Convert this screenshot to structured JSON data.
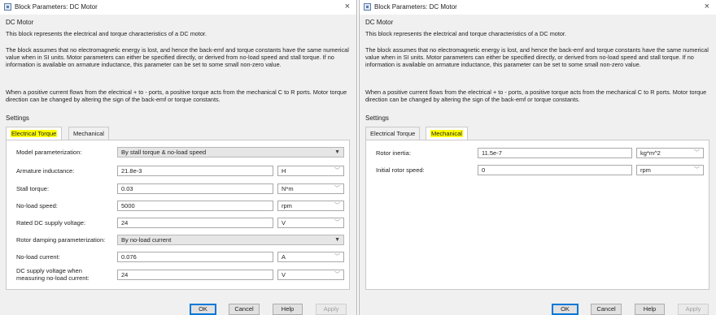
{
  "left": {
    "window_title": "Block Parameters: DC Motor",
    "close_glyph": "×",
    "block_name": "DC Motor",
    "description": [
      "This block represents the electrical and torque characteristics of a DC motor.",
      "The block assumes that no electromagnetic energy is lost, and hence the back-emf and torque constants have the same numerical value when in SI units. Motor parameters can either be specified directly, or derived from no-load speed and stall torque. If no information is available on armature inductance, this parameter can be set to some small non-zero value.",
      "When a positive current flows from the electrical + to - ports, a positive torque acts from the mechanical C to R ports. Motor torque direction can be changed by altering the sign of the back-emf or torque constants."
    ],
    "settings_label": "Settings",
    "tabs": [
      {
        "label": "Electrical Torque"
      },
      {
        "label": "Mechanical"
      }
    ],
    "params": {
      "model_param": {
        "label": "Model parameterization:",
        "value": "By stall torque & no-load speed"
      },
      "armature_inductance": {
        "label": "Armature inductance:",
        "value": "21.8e-3",
        "unit": "H"
      },
      "stall_torque": {
        "label": "Stall torque:",
        "value": "0.03",
        "unit": "N*m"
      },
      "no_load_speed": {
        "label": "No-load speed:",
        "value": "5000",
        "unit": "rpm"
      },
      "rated_dc_voltage": {
        "label": "Rated DC supply voltage:",
        "value": "24",
        "unit": "V"
      },
      "rotor_damping": {
        "label": "Rotor damping parameterization:",
        "value": "By no-load current"
      },
      "no_load_current": {
        "label": "No-load current:",
        "value": "0.076",
        "unit": "A"
      },
      "dc_supply_no_load": {
        "label_line1": "DC supply voltage when",
        "label_line2": "measuring no-load current:",
        "value": "24",
        "unit": "V"
      }
    },
    "buttons": {
      "ok": "OK",
      "cancel": "Cancel",
      "help": "Help",
      "apply": "Apply"
    }
  },
  "right": {
    "window_title": "Block Parameters: DC Motor",
    "close_glyph": "×",
    "block_name": "DC Motor",
    "description": [
      "This block represents the electrical and torque characteristics of a DC motor.",
      "The block assumes that no electromagnetic energy is lost, and hence the back-emf and torque constants have the same numerical value when in SI units. Motor parameters can either be specified directly, or derived from no-load speed and stall torque. If no information is available on armature inductance, this parameter can be set to some small non-zero value.",
      "When a positive current flows from the electrical + to - ports, a positive torque acts from the mechanical C to R ports. Motor torque direction can be changed by altering the sign of the back-emf or torque constants."
    ],
    "settings_label": "Settings",
    "tabs": [
      {
        "label": "Electrical Torque"
      },
      {
        "label": "Mechanical"
      }
    ],
    "params": {
      "rotor_inertia": {
        "label": "Rotor inertia:",
        "value": "11.5e-7",
        "unit": "kg*m^2"
      },
      "initial_rotor_speed": {
        "label": "Initial rotor speed:",
        "value": "0",
        "unit": "rpm"
      }
    },
    "buttons": {
      "ok": "OK",
      "cancel": "Cancel",
      "help": "Help",
      "apply": "Apply"
    }
  },
  "colors": {
    "tab_highlight": "#ffff00",
    "dialog_bg": "#f0f0f0",
    "ok_focus_border": "#0078d7"
  }
}
